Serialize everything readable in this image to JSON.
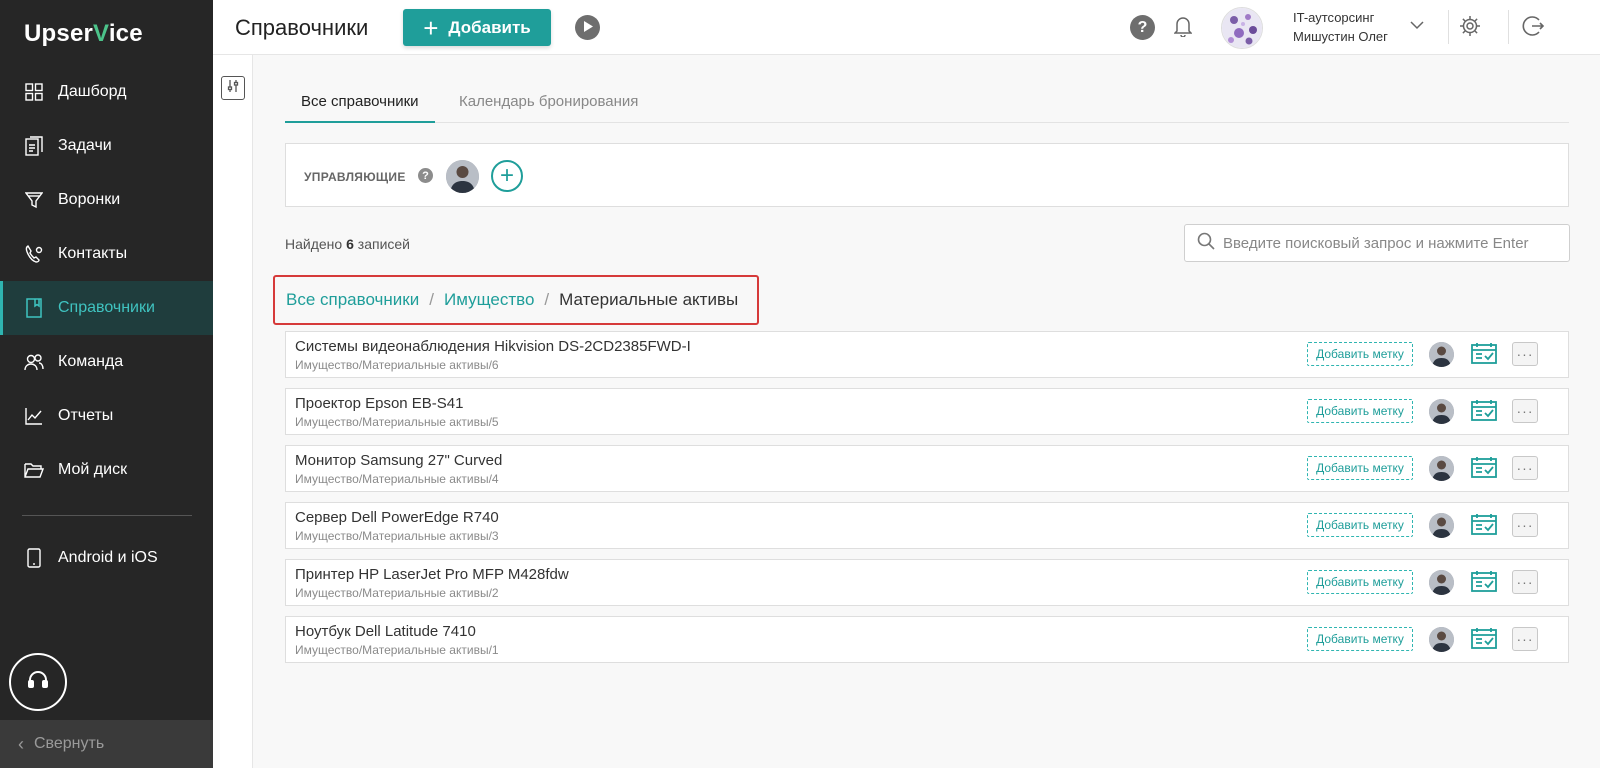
{
  "app": {
    "logo_prefix": "Upser",
    "logo_check": "V",
    "logo_suffix": "ice"
  },
  "sidebar": {
    "items": [
      {
        "label": "Дашборд",
        "icon": "dashboard-icon"
      },
      {
        "label": "Задачи",
        "icon": "tasks-icon"
      },
      {
        "label": "Воронки",
        "icon": "funnel-icon"
      },
      {
        "label": "Контакты",
        "icon": "contacts-icon"
      },
      {
        "label": "Справочники",
        "icon": "book-icon",
        "active": true
      },
      {
        "label": "Команда",
        "icon": "team-icon"
      },
      {
        "label": "Отчеты",
        "icon": "chart-icon"
      },
      {
        "label": "Мой диск",
        "icon": "folder-icon"
      }
    ],
    "mobile_label": "Android и iOS",
    "collapse_label": "Свернуть"
  },
  "topbar": {
    "title": "Справочники",
    "add_label": "Добавить",
    "org": "IT-аутсорсинг",
    "user": "Мишустин Олег"
  },
  "tabs": [
    {
      "label": "Все справочники",
      "active": true
    },
    {
      "label": "Календарь бронирования",
      "active": false
    }
  ],
  "managers": {
    "label": "УПРАВЛЯЮЩИЕ"
  },
  "results": {
    "prefix": "Найдено",
    "count": "6",
    "suffix": "записей"
  },
  "search": {
    "placeholder": "Введите поисковый запрос и нажмите Enter"
  },
  "breadcrumb": {
    "root": "Все справочники",
    "sep": "/",
    "parent": "Имущество",
    "current": "Материальные активы"
  },
  "rows": [
    {
      "title": "Системы видеонаблюдения Hikvision DS-2CD2385FWD-I",
      "path": "Имущество/Материальные активы/6",
      "tag": "Добавить метку"
    },
    {
      "title": "Проектор Epson EB-S41",
      "path": "Имущество/Материальные активы/5",
      "tag": "Добавить метку"
    },
    {
      "title": "Монитор Samsung 27\" Curved",
      "path": "Имущество/Материальные активы/4",
      "tag": "Добавить метку"
    },
    {
      "title": "Сервер Dell PowerEdge R740",
      "path": "Имущество/Материальные активы/3",
      "tag": "Добавить метку"
    },
    {
      "title": "Принтер HP LaserJet Pro MFP M428fdw",
      "path": "Имущество/Материальные активы/2",
      "tag": "Добавить метку"
    },
    {
      "title": "Ноутбук Dell Latitude 7410",
      "path": "Имущество/Материальные активы/1",
      "tag": "Добавить метку"
    }
  ],
  "colors": {
    "accent": "#1f9e9a",
    "sidebar_bg": "#262626",
    "active_nav_bg": "#1f3d3d",
    "highlight_border": "#d63a3a"
  }
}
